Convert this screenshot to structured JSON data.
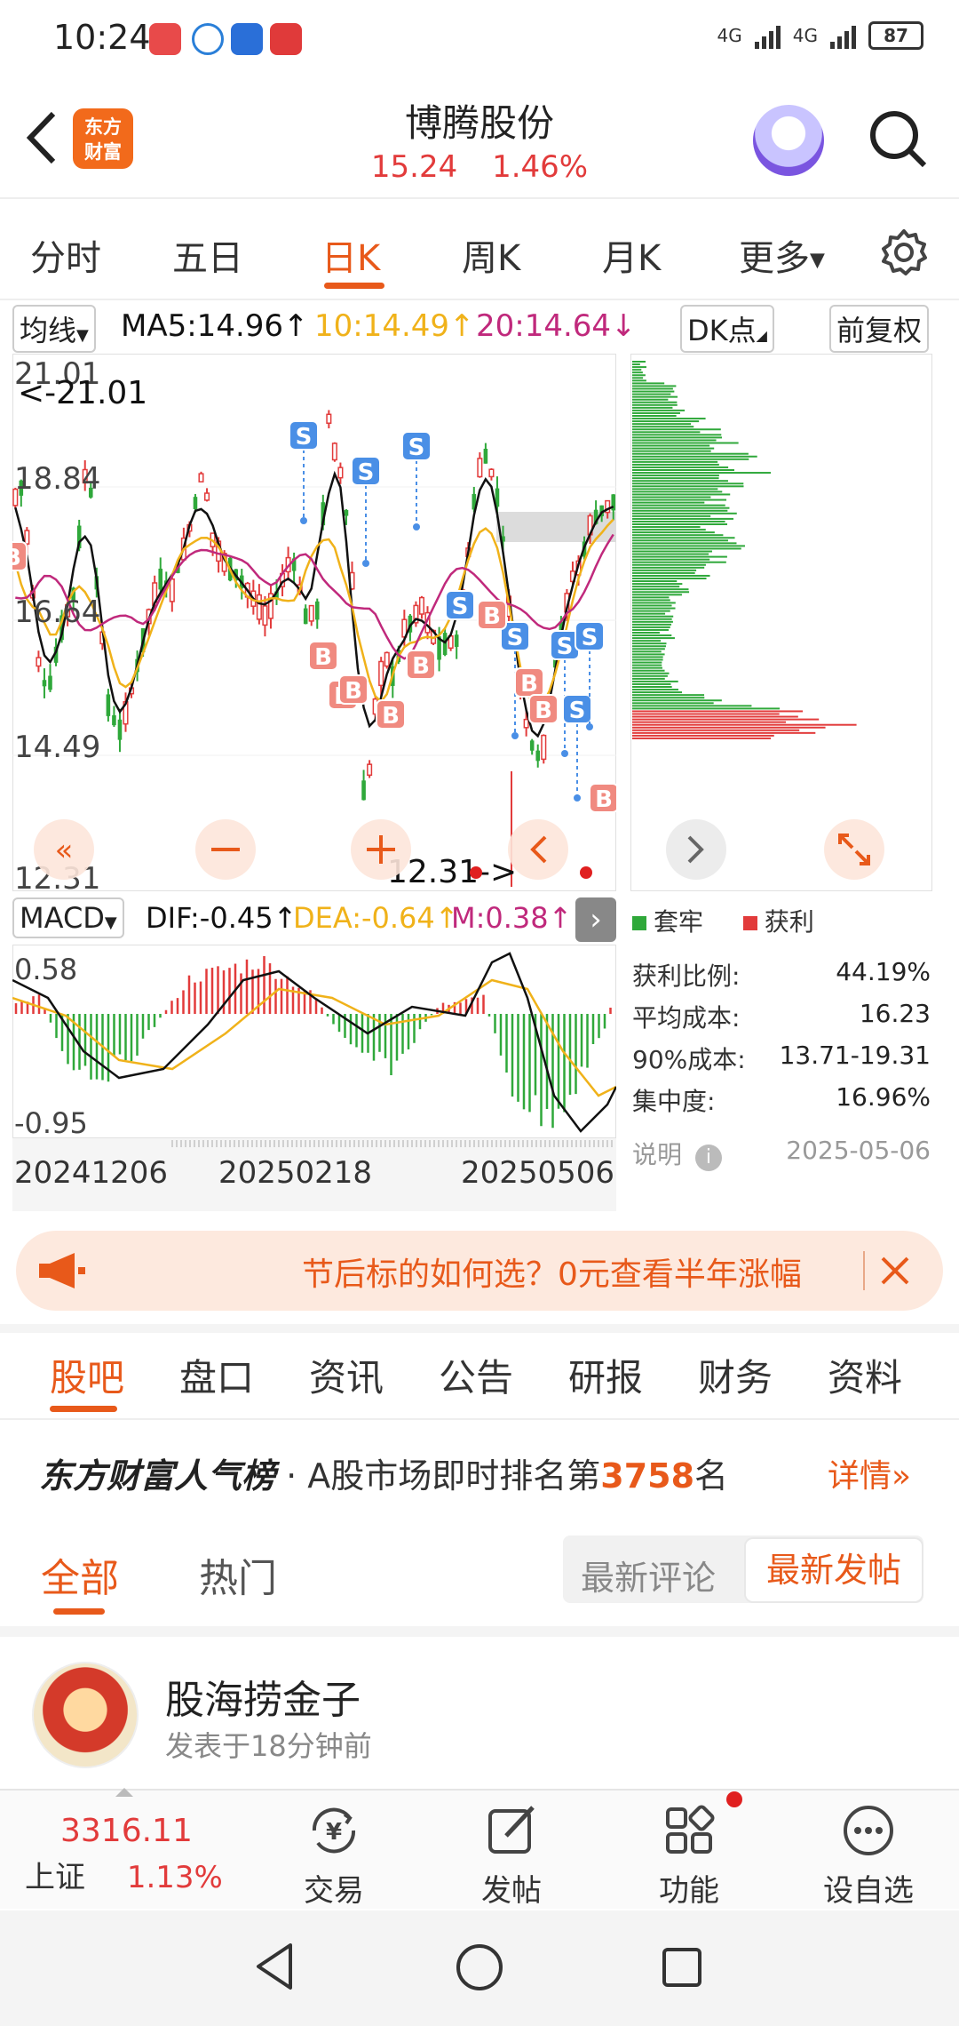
{
  "status_bar": {
    "time": "10:24",
    "network_1": "4G",
    "network_2": "4G",
    "battery": "87"
  },
  "header": {
    "logo_text": "东方财富",
    "stock_name": "博腾股份",
    "price": "15.24",
    "change_pct": "1.46%"
  },
  "period_tabs": [
    "分时",
    "五日",
    "日K",
    "周K",
    "月K",
    "更多"
  ],
  "active_period": "日K",
  "indicator_row": {
    "ma_select": "均线",
    "ma5": "MA5:14.96↑",
    "ma10": "10:14.49↑",
    "ma20": "20:14.64↓",
    "dk_select": "DK点",
    "adjust_button": "前复权"
  },
  "kline": {
    "y_ticks": [
      "21.01",
      "18.84",
      "16.64",
      "14.49",
      "12.31"
    ],
    "high_label": "<-21.01",
    "low_label": "12.31->",
    "buy_marker": "B",
    "sell_marker": "S"
  },
  "macd": {
    "select": "MACD",
    "dif": "DIF:-0.45↑",
    "dea": "DEA:-0.64↑",
    "m": "M:0.38↑",
    "y_top": "0.58",
    "y_bottom": "-0.95",
    "dates": [
      "20241206",
      "20250218",
      "20250506"
    ]
  },
  "chip_distribution": {
    "legend_trapped": "套牢",
    "legend_profit": "获利",
    "stats": [
      {
        "label": "获利比例:",
        "value": "44.19%"
      },
      {
        "label": "平均成本:",
        "value": "16.23"
      },
      {
        "label": "90%成本:",
        "value": "13.71-19.31"
      },
      {
        "label": "集中度:",
        "value": "16.96%"
      }
    ],
    "note_label": "说明",
    "date": "2025-05-06"
  },
  "promo": {
    "text": "节后标的如何选？0元查看半年涨幅"
  },
  "section_tabs": [
    "股吧",
    "盘口",
    "资讯",
    "公告",
    "研报",
    "财务",
    "资料"
  ],
  "active_section": "股吧",
  "ranking": {
    "brand": "东方财富人气榜",
    "prefix": "· A股市场即时排名第",
    "rank": "3758",
    "suffix": "名",
    "details": "详情"
  },
  "sub_tabs": {
    "all": "全部",
    "hot": "热门",
    "latest_reply": "最新评论",
    "latest_post": "最新发帖"
  },
  "post": {
    "author": "股海捞金子",
    "time": "发表于18分钟前"
  },
  "bottom_bar": {
    "index_value": "3316.11",
    "index_name": "上证",
    "index_change": "1.13%",
    "items": [
      "交易",
      "发帖",
      "功能",
      "设自选"
    ]
  },
  "colors": {
    "accent": "#e8591a",
    "up": "#e23b3b",
    "down": "#2fa83a",
    "ma5": "#111111",
    "ma10": "#f0b21a",
    "ma20": "#c0297c"
  }
}
